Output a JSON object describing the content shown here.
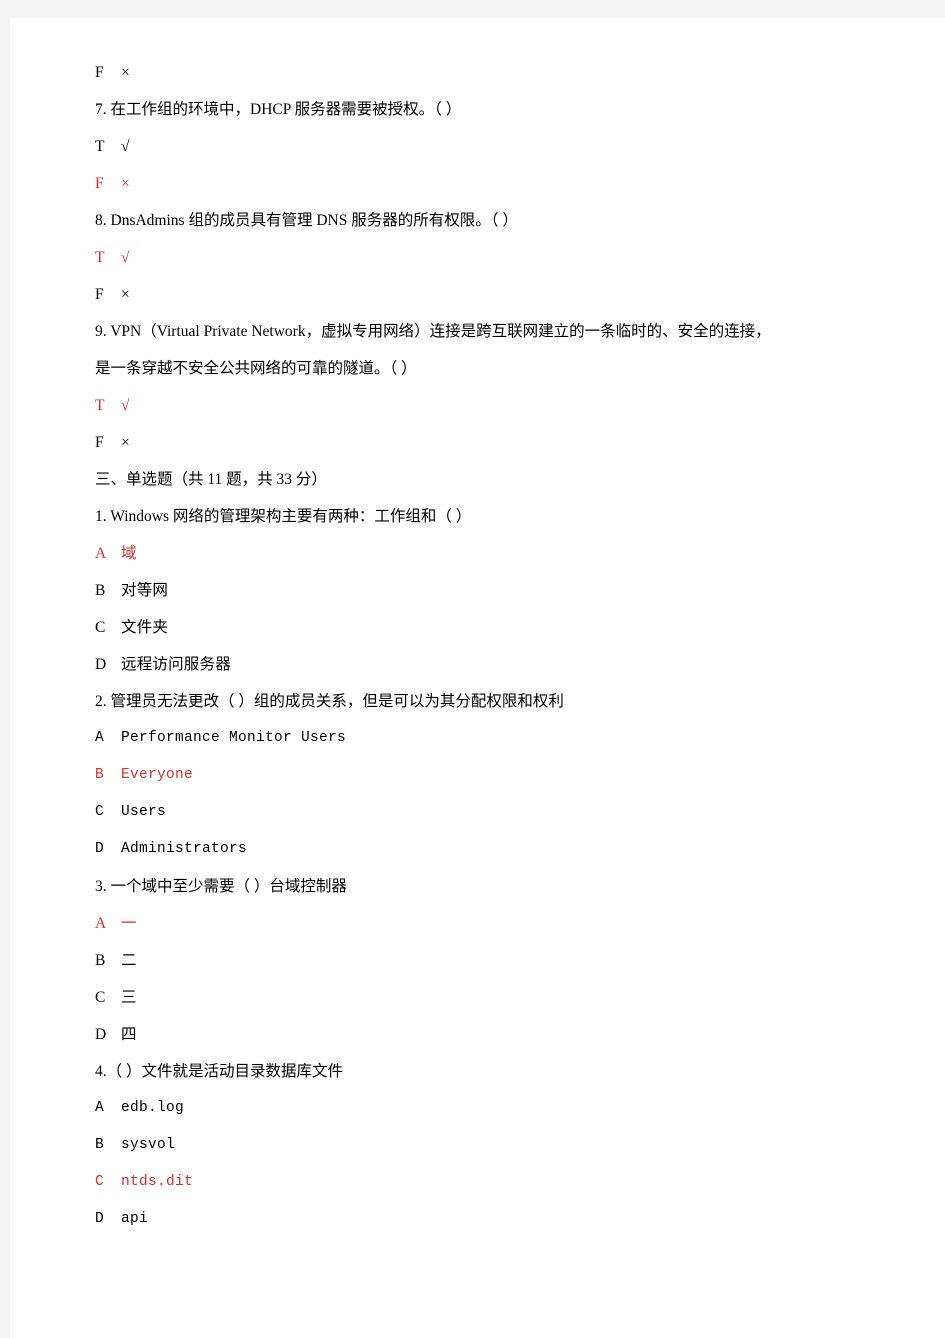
{
  "page": {
    "background_color": "#f4f4f4",
    "paper_color": "#ffffff",
    "answer_color": "#d4302a",
    "text_color": "#000000"
  },
  "glyphs": {
    "check": "√",
    "cross": "×"
  },
  "blocks": [
    {
      "kind": "answer-row",
      "name": "tf-option-f-orphan",
      "letter": "F",
      "mark": "×",
      "highlighted": false
    },
    {
      "kind": "question",
      "name": "tf-question-7",
      "lines": [
        "7. 在工作组的环境中，DHCP 服务器需要被授权。（ ）"
      ]
    },
    {
      "kind": "answer-row",
      "name": "tf-7-option-t",
      "letter": "T",
      "mark": "√",
      "highlighted": false
    },
    {
      "kind": "answer-row",
      "name": "tf-7-option-f",
      "letter": "F",
      "mark": "×",
      "highlighted": true
    },
    {
      "kind": "question",
      "name": "tf-question-8",
      "lines": [
        "8. DnsAdmins 组的成员具有管理 DNS 服务器的所有权限。（ ）"
      ]
    },
    {
      "kind": "answer-row",
      "name": "tf-8-option-t",
      "letter": "T",
      "mark": "√",
      "highlighted": true
    },
    {
      "kind": "answer-row",
      "name": "tf-8-option-f",
      "letter": "F",
      "mark": "×",
      "highlighted": false
    },
    {
      "kind": "question",
      "name": "tf-question-9",
      "lines": [
        "9. VPN（Virtual Private Network，虚拟专用网络）连接是跨互联网建立的一条临时的、安全的连接，",
        "是一条穿越不安全公共网络的可靠的隧道。（ ）"
      ]
    },
    {
      "kind": "answer-row",
      "name": "tf-9-option-t",
      "letter": "T",
      "mark": "√",
      "highlighted": true
    },
    {
      "kind": "answer-row",
      "name": "tf-9-option-f",
      "letter": "F",
      "mark": "×",
      "highlighted": false
    },
    {
      "kind": "section-heading",
      "name": "section-heading-single-choice",
      "text": "三、单选题（共 11 题，共 33 分）"
    },
    {
      "kind": "question",
      "name": "mc-question-1",
      "lines": [
        "1. Windows 网络的管理架构主要有两种：工作组和（ ）"
      ]
    },
    {
      "kind": "option",
      "name": "mc-1-option-a",
      "letter": "A",
      "text": "域",
      "highlighted": true,
      "mono": false
    },
    {
      "kind": "option",
      "name": "mc-1-option-b",
      "letter": "B",
      "text": "对等网",
      "highlighted": false,
      "mono": false
    },
    {
      "kind": "option",
      "name": "mc-1-option-c",
      "letter": "C",
      "text": "文件夹",
      "highlighted": false,
      "mono": false
    },
    {
      "kind": "option",
      "name": "mc-1-option-d",
      "letter": "D",
      "text": "远程访问服务器",
      "highlighted": false,
      "mono": false
    },
    {
      "kind": "question",
      "name": "mc-question-2",
      "lines": [
        "2. 管理员无法更改（ ）组的成员关系，但是可以为其分配权限和权利"
      ]
    },
    {
      "kind": "option",
      "name": "mc-2-option-a",
      "letter": "A",
      "text": "Performance Monitor Users",
      "highlighted": false,
      "mono": true
    },
    {
      "kind": "option",
      "name": "mc-2-option-b",
      "letter": "B",
      "text": "Everyone",
      "highlighted": true,
      "mono": true
    },
    {
      "kind": "option",
      "name": "mc-2-option-c",
      "letter": "C",
      "text": "Users",
      "highlighted": false,
      "mono": true
    },
    {
      "kind": "option",
      "name": "mc-2-option-d",
      "letter": "D",
      "text": "Administrators",
      "highlighted": false,
      "mono": true
    },
    {
      "kind": "question",
      "name": "mc-question-3",
      "lines": [
        "3. 一个域中至少需要（ ）台域控制器"
      ]
    },
    {
      "kind": "option",
      "name": "mc-3-option-a",
      "letter": "A",
      "text": "一",
      "highlighted": true,
      "mono": false
    },
    {
      "kind": "option",
      "name": "mc-3-option-b",
      "letter": "B",
      "text": "二",
      "highlighted": false,
      "mono": false
    },
    {
      "kind": "option",
      "name": "mc-3-option-c",
      "letter": "C",
      "text": "三",
      "highlighted": false,
      "mono": false
    },
    {
      "kind": "option",
      "name": "mc-3-option-d",
      "letter": "D",
      "text": "四",
      "highlighted": false,
      "mono": false
    },
    {
      "kind": "question",
      "name": "mc-question-4",
      "lines": [
        "4.（ ）文件就是活动目录数据库文件"
      ]
    },
    {
      "kind": "option",
      "name": "mc-4-option-a",
      "letter": "A",
      "text": "edb.log",
      "highlighted": false,
      "mono": true
    },
    {
      "kind": "option",
      "name": "mc-4-option-b",
      "letter": "B",
      "text": "sysvol",
      "highlighted": false,
      "mono": true
    },
    {
      "kind": "option",
      "name": "mc-4-option-c",
      "letter": "C",
      "text": "ntds.dit",
      "highlighted": true,
      "mono": true
    },
    {
      "kind": "option",
      "name": "mc-4-option-d",
      "letter": "D",
      "text": "api",
      "highlighted": false,
      "mono": true
    }
  ]
}
